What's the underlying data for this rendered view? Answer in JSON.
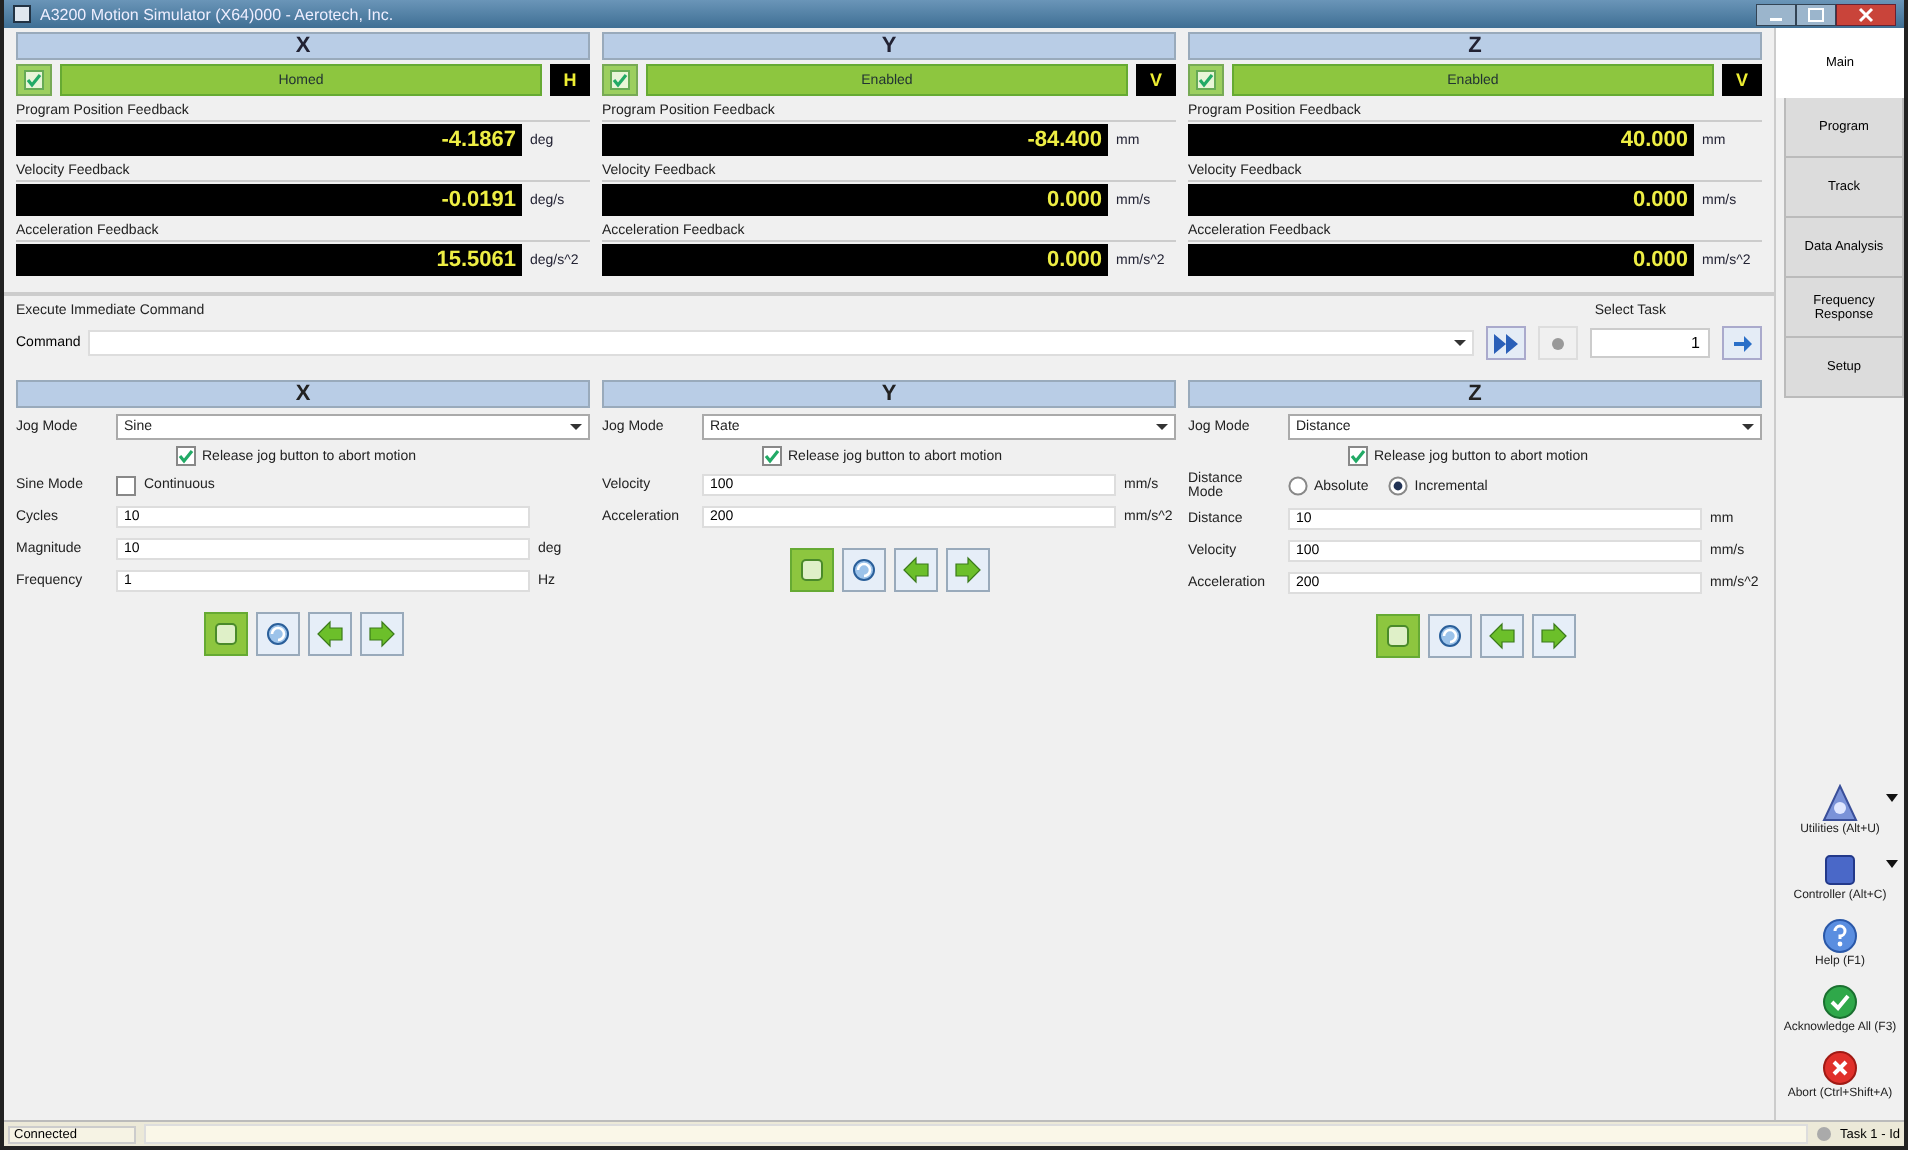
{
  "window": {
    "title": "A3200 Motion Simulator (X64)000 - Aerotech, Inc."
  },
  "axes": [
    {
      "name": "X",
      "enabled": true,
      "status": "Homed",
      "indicator": "H",
      "readouts": [
        {
          "label": "Program Position Feedback",
          "value": "-4.1867",
          "unit": "deg"
        },
        {
          "label": "Velocity Feedback",
          "value": "-0.0191",
          "unit": "deg/s"
        },
        {
          "label": "Acceleration Feedback",
          "value": "15.5061",
          "unit": "deg/s^2"
        }
      ]
    },
    {
      "name": "Y",
      "enabled": true,
      "status": "Enabled",
      "indicator": "V",
      "readouts": [
        {
          "label": "Program Position Feedback",
          "value": "-84.400",
          "unit": "mm"
        },
        {
          "label": "Velocity Feedback",
          "value": "0.000",
          "unit": "mm/s"
        },
        {
          "label": "Acceleration Feedback",
          "value": "0.000",
          "unit": "mm/s^2"
        }
      ]
    },
    {
      "name": "Z",
      "enabled": true,
      "status": "Enabled",
      "indicator": "V",
      "readouts": [
        {
          "label": "Program Position Feedback",
          "value": "40.000",
          "unit": "mm"
        },
        {
          "label": "Velocity Feedback",
          "value": "0.000",
          "unit": "mm/s"
        },
        {
          "label": "Acceleration Feedback",
          "value": "0.000",
          "unit": "mm/s^2"
        }
      ]
    }
  ],
  "command": {
    "section_title": "Execute Immediate Command",
    "label": "Command",
    "task_label": "Select Task",
    "task": "1"
  },
  "jog_panels": [
    {
      "axis": "X",
      "mode_label": "Jog Mode",
      "mode": "Sine",
      "release_label": "Release jog button to abort motion",
      "release_checked": true,
      "rows": [
        {
          "kind": "checkbox",
          "label": "Sine Mode",
          "option": "Continuous",
          "checked": false
        },
        {
          "kind": "field",
          "label": "Cycles",
          "value": "10"
        },
        {
          "kind": "field",
          "label": "Magnitude",
          "value": "10",
          "unit": "deg"
        },
        {
          "kind": "field",
          "label": "Frequency",
          "value": "1",
          "unit": "Hz"
        }
      ]
    },
    {
      "axis": "Y",
      "mode_label": "Jog Mode",
      "mode": "Rate",
      "release_label": "Release jog button to abort motion",
      "release_checked": true,
      "rows": [
        {
          "kind": "field",
          "label": "Velocity",
          "value": "100",
          "unit": "mm/s"
        },
        {
          "kind": "field",
          "label": "Acceleration",
          "value": "200",
          "unit": "mm/s^2"
        }
      ]
    },
    {
      "axis": "Z",
      "mode_label": "Jog Mode",
      "mode": "Distance",
      "release_label": "Release jog button to abort motion",
      "release_checked": true,
      "rows": [
        {
          "kind": "radio",
          "label": "Distance Mode",
          "options": [
            {
              "label": "Absolute",
              "selected": false
            },
            {
              "label": "Incremental",
              "selected": true
            }
          ]
        },
        {
          "kind": "field",
          "label": "Distance",
          "value": "10",
          "unit": "mm"
        },
        {
          "kind": "field",
          "label": "Velocity",
          "value": "100",
          "unit": "mm/s"
        },
        {
          "kind": "field",
          "label": "Acceleration",
          "value": "200",
          "unit": "mm/s^2"
        }
      ]
    }
  ],
  "sidebar": {
    "tabs": [
      {
        "label": "Main",
        "selected": true
      },
      {
        "label": "Program",
        "selected": false
      },
      {
        "label": "Track",
        "selected": false
      },
      {
        "label": "Data Analysis",
        "selected": false
      },
      {
        "label": "Frequency Response",
        "selected": false
      },
      {
        "label": "Setup",
        "selected": false
      }
    ],
    "tools": [
      {
        "kind": "utilities",
        "label": "Utilities (Alt+U)",
        "menu": true
      },
      {
        "kind": "controller",
        "label": "Controller (Alt+C)",
        "menu": true
      },
      {
        "kind": "help",
        "label": "Help (F1)",
        "menu": false
      },
      {
        "kind": "acknowledge",
        "label": "Acknowledge All (F3)",
        "menu": false
      },
      {
        "kind": "abort",
        "label": "Abort (Ctrl+Shift+A)",
        "menu": false
      }
    ]
  },
  "status_bar": {
    "left": "Connected",
    "right": "Task 1 - Id"
  }
}
